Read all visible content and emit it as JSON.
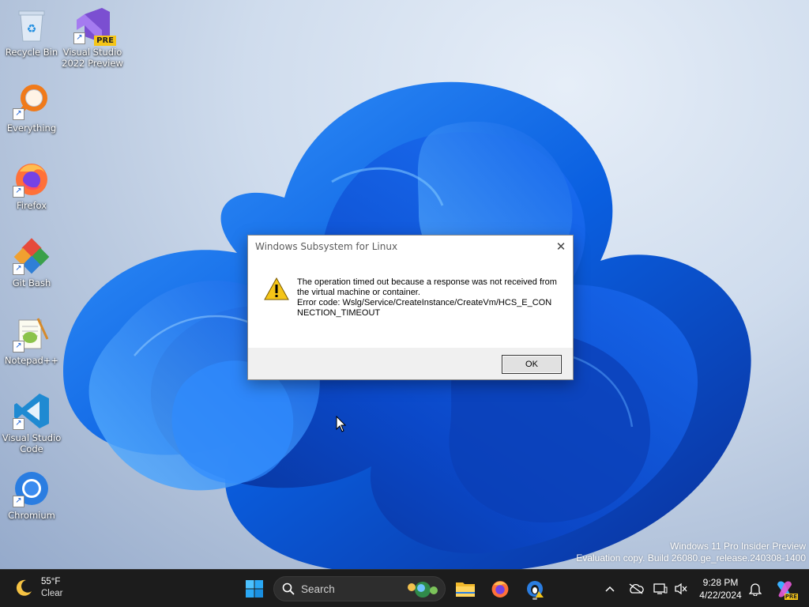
{
  "desktop_icons": [
    {
      "id": "recycle-bin",
      "label": "Recycle Bin"
    },
    {
      "id": "visual-studio-2022-preview",
      "label": "Visual Studio 2022 Preview",
      "badge": "PRE"
    },
    {
      "id": "everything",
      "label": "Everything"
    },
    {
      "id": "firefox",
      "label": "Firefox"
    },
    {
      "id": "git-bash",
      "label": "Git Bash"
    },
    {
      "id": "notepad-plus-plus",
      "label": "Notepad++"
    },
    {
      "id": "visual-studio-code",
      "label": "Visual Studio Code"
    },
    {
      "id": "chromium",
      "label": "Chromium"
    }
  ],
  "dialog": {
    "title": "Windows Subsystem for Linux",
    "icon": "warning-icon",
    "message_lines": [
      "The operation timed out because a response was not received from the virtual machine or container.",
      "Error code: Wslg/Service/CreateInstance/CreateVm/HCS_E_CONNECTION_TIMEOUT"
    ],
    "ok_label": "OK"
  },
  "watermark": {
    "line1": "Windows 11 Pro Insider Preview",
    "line2": "Evaluation copy. Build 26080.ge_release.240308-1400"
  },
  "taskbar": {
    "weather": {
      "temperature": "55°F",
      "condition": "Clear",
      "icon": "moon-icon"
    },
    "search": {
      "placeholder": "Search"
    },
    "pinned": [
      "start",
      "file-explorer",
      "firefox",
      "wsl-settings"
    ],
    "tray_icons": [
      "chevron-up-icon",
      "onedrive-offline-icon",
      "display-icon",
      "volume-muted-icon"
    ],
    "clock": {
      "time": "9:28 PM",
      "date": "4/22/2024"
    },
    "copilot_badge": "PRE"
  },
  "colors": {
    "accent": "#0a5fe0",
    "taskbar": "#1c1c1c",
    "dialog_footer": "#f0f0f0",
    "warning": "#f5c518"
  }
}
